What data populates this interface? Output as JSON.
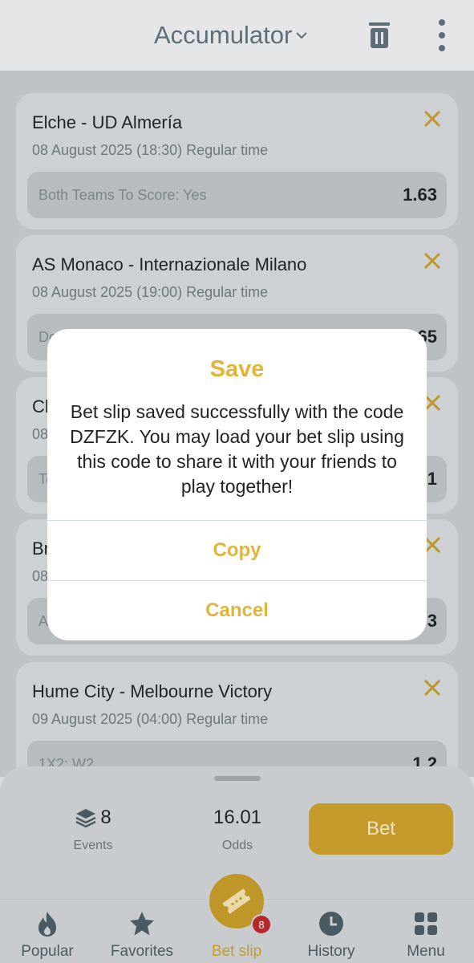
{
  "header": {
    "title": "Accumulator"
  },
  "matches": [
    {
      "teams": "Elche - UD Almería",
      "date": "08 August 2025 (18:30) Regular time",
      "market": "Both Teams To Score: Yes",
      "odds": "1.63"
    },
    {
      "teams": "AS Monaco - Internazionale Milano",
      "date": "08 August 2025 (19:00) Regular time",
      "market": "Do",
      "odds": "65"
    },
    {
      "teams": "Ch",
      "date": "08",
      "market": "To",
      "odds": "1"
    },
    {
      "teams": "Br",
      "date": "08",
      "market": "A",
      "odds": "3"
    },
    {
      "teams": "Hume City - Melbourne Victory",
      "date": "09 August 2025 (04:00) Regular time",
      "market": "1X2: W2",
      "odds": "1.2"
    }
  ],
  "summary": {
    "events_count": "8",
    "events_label": "Events",
    "odds_value": "16.01",
    "odds_label": "Odds",
    "bet_label": "Bet"
  },
  "nav": {
    "items": [
      {
        "label": "Popular",
        "icon": "flame-icon"
      },
      {
        "label": "Favorites",
        "icon": "star-icon"
      },
      {
        "label": "Bet slip",
        "icon": "ticket-icon"
      },
      {
        "label": "History",
        "icon": "clock-icon"
      },
      {
        "label": "Menu",
        "icon": "grid-icon"
      }
    ],
    "betslip_badge": "8"
  },
  "modal": {
    "title": "Save",
    "message": "Bet slip saved successfully with the code DZFZK. You may load your bet slip using this code to share it with your friends to play together!",
    "copy_label": "Copy",
    "cancel_label": "Cancel"
  },
  "colors": {
    "accent": "#e2b43a",
    "bet_button": "#c49a2a",
    "badge": "#b8262a"
  }
}
